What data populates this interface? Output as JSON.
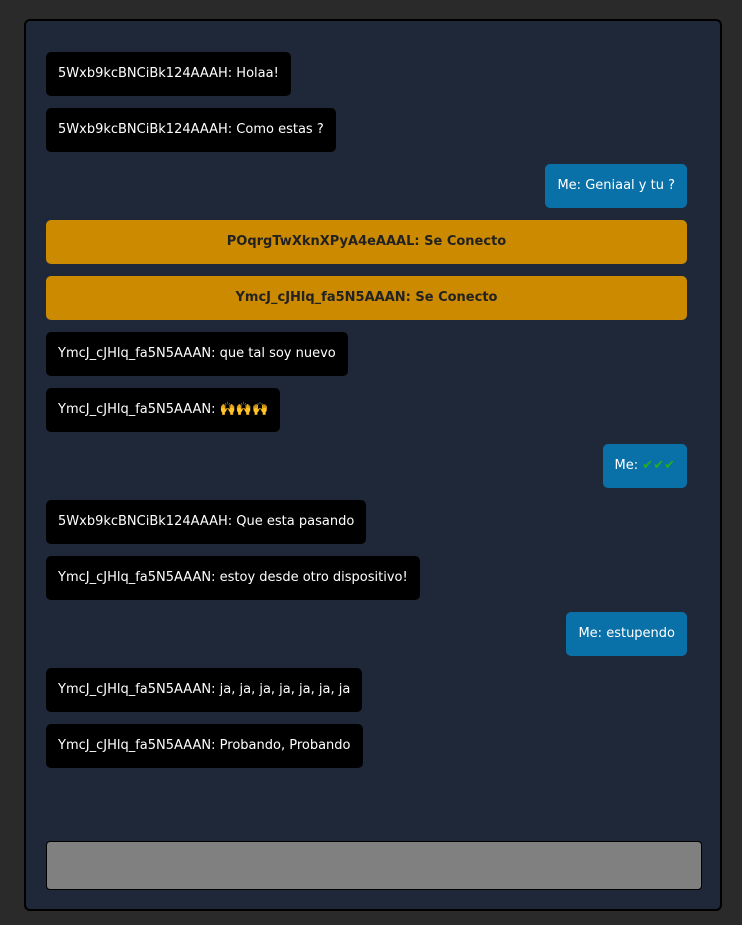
{
  "messages": [
    {
      "kind": "incoming",
      "text": "5Wxb9kcBNCiBk124AAAH: Holaa!"
    },
    {
      "kind": "incoming",
      "text": "5Wxb9kcBNCiBk124AAAH: Como estas ?"
    },
    {
      "kind": "outgoing",
      "text": "Me: Geniaal y tu ?"
    },
    {
      "kind": "system",
      "text": "POqrgTwXknXPyA4eAAAL: Se Conecto"
    },
    {
      "kind": "system",
      "text": "YmcJ_cJHlq_fa5N5AAAN: Se Conecto"
    },
    {
      "kind": "incoming",
      "text": "YmcJ_cJHlq_fa5N5AAAN: que tal soy nuevo"
    },
    {
      "kind": "incoming",
      "text": "YmcJ_cJHlq_fa5N5AAAN: 🙌🙌🙌"
    },
    {
      "kind": "outgoing",
      "text": "Me: ✔✔✔"
    },
    {
      "kind": "incoming",
      "text": "5Wxb9kcBNCiBk124AAAH: Que esta pasando"
    },
    {
      "kind": "incoming",
      "text": "YmcJ_cJHlq_fa5N5AAAN: estoy desde otro dispositivo!"
    },
    {
      "kind": "outgoing",
      "text": "Me: estupendo"
    },
    {
      "kind": "incoming",
      "text": "YmcJ_cJHlq_fa5N5AAAN: ja, ja, ja, ja, ja, ja, ja"
    },
    {
      "kind": "incoming",
      "text": "YmcJ_cJHlq_fa5N5AAAN: Probando, Probando"
    }
  ],
  "input": {
    "value": "",
    "placeholder": ""
  },
  "colors": {
    "incoming_bubble": "#000000",
    "outgoing_bubble": "#0a70a8",
    "system_bubble": "#cc8a00",
    "window_bg": "#1f2839",
    "input_bg": "#808080"
  }
}
